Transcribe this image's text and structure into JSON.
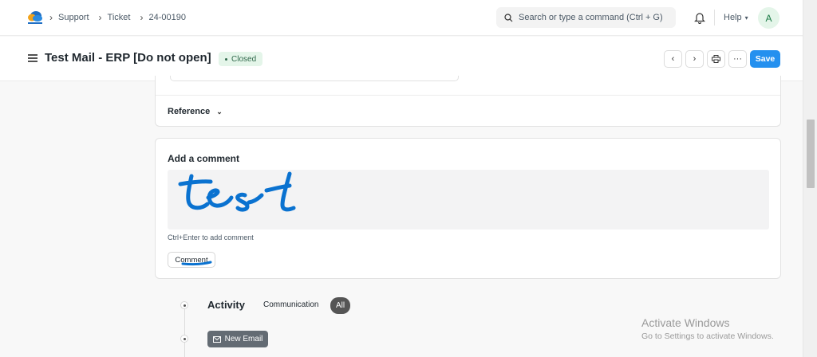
{
  "navbar": {
    "breadcrumbs": [
      "Support",
      "Ticket",
      "24-00190"
    ],
    "search_placeholder": "Search or type a command (Ctrl + G)",
    "help_label": "Help",
    "avatar_initial": "A"
  },
  "page": {
    "title": "Test Mail - ERP [Do not open]",
    "status": "Closed",
    "save_label": "Save"
  },
  "reference_section": {
    "label": "Reference"
  },
  "comment": {
    "title": "Add a comment",
    "hint": "Ctrl+Enter to add comment",
    "button_label": "Comment",
    "handwritten_text": "test"
  },
  "activity": {
    "title": "Activity",
    "tabs": [
      "Communication",
      "All"
    ],
    "active_tab": "All",
    "new_email_label": "New Email"
  },
  "watermark": {
    "line1": "Activate Windows",
    "line2": "Go to Settings to activate Windows."
  },
  "colors": {
    "primary": "#2490ef",
    "status_bg": "#e4f5e9",
    "status_text": "#30694b",
    "annotation_ink": "#0a72d0"
  }
}
